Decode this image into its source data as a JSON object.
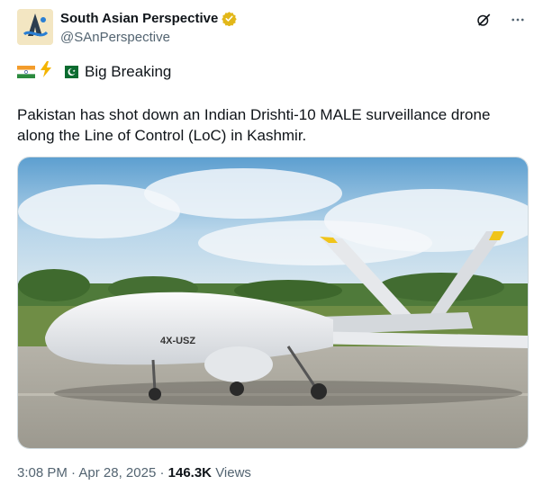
{
  "author": {
    "name": "South Asian Perspective",
    "handle": "@SAnPerspective",
    "verified": true,
    "badge_color": "#e2b719"
  },
  "actions": {
    "icons": [
      "grok-icon",
      "more-icon"
    ]
  },
  "post": {
    "headline_label": "Big Breaking",
    "text": "Pakistan has shot down an Indian Drishti-10 MALE surveillance drone along the Line of Control (LoC) in Kashmir.",
    "image_tail_number": "4X-USZ"
  },
  "meta": {
    "time": "3:08 PM",
    "separator": "·",
    "date": "Apr 28, 2025",
    "views_count": "146.3K",
    "views_label": "Views"
  },
  "colors": {
    "text": "#0f1419",
    "secondary": "#536471",
    "border": "#cfd9de"
  }
}
